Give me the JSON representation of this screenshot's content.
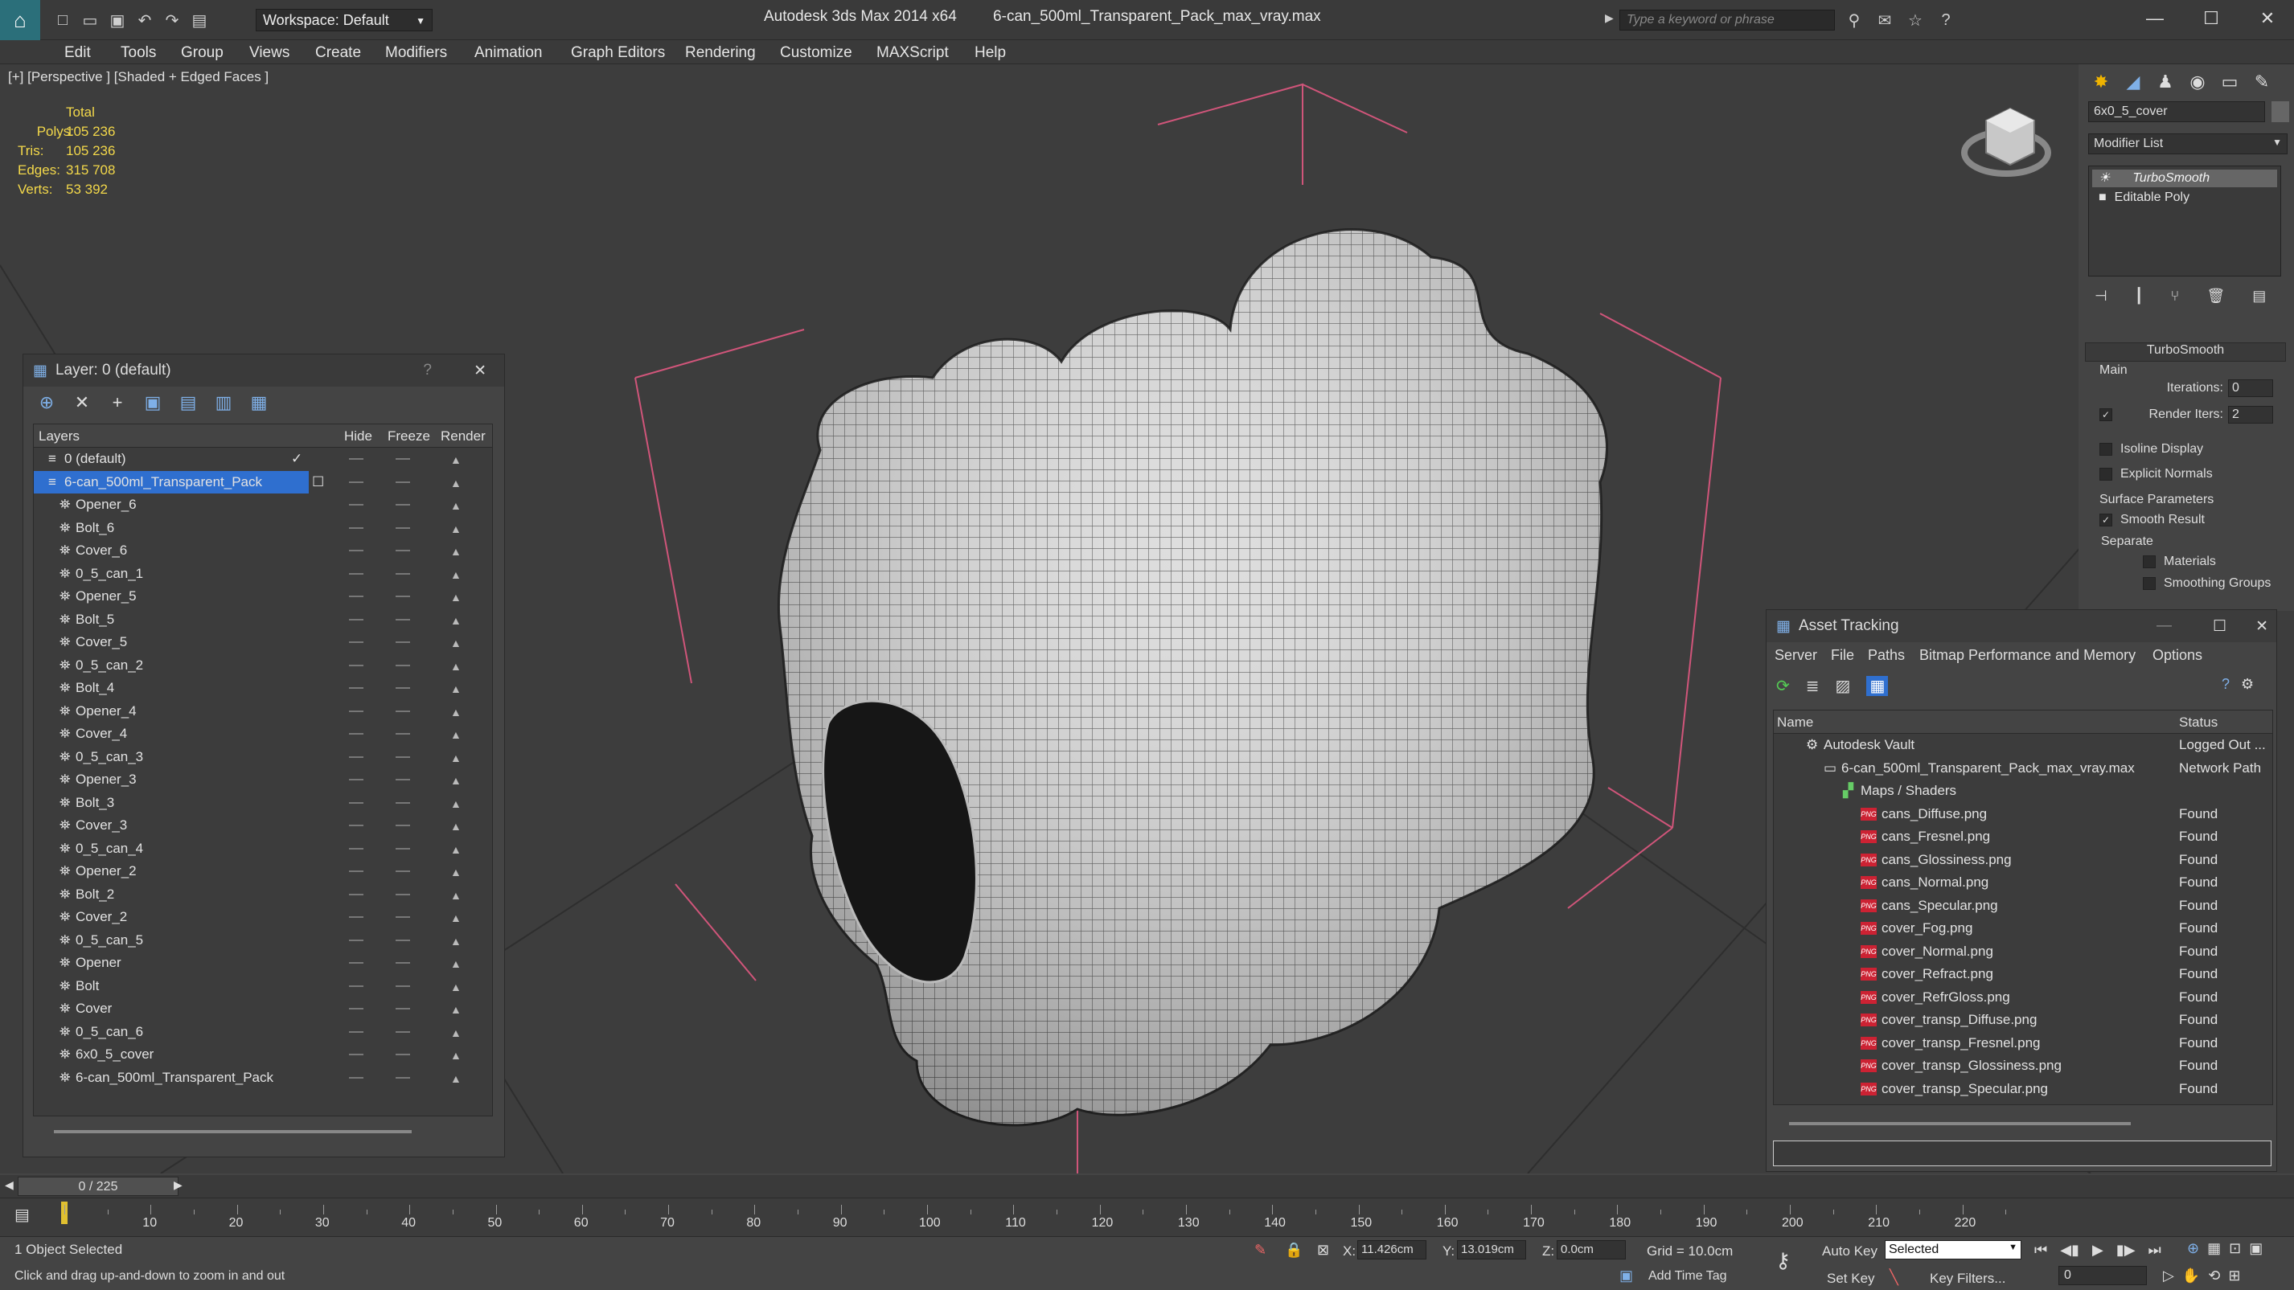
{
  "titlebar": {
    "workspace": "Workspace: Default",
    "app": "Autodesk 3ds Max  2014 x64",
    "file": "6-can_500ml_Transparent_Pack_max_vray.max",
    "search_placeholder": "Type a keyword or phrase"
  },
  "menu": [
    "Edit",
    "Tools",
    "Group",
    "Views",
    "Create",
    "Modifiers",
    "Animation",
    "Graph Editors",
    "Rendering",
    "Customize",
    "MAXScript",
    "Help"
  ],
  "viewport": {
    "label": "[+] [Perspective ] [Shaded + Edged Faces ]",
    "stats_total": "Total",
    "stats": [
      {
        "label": "Polys:",
        "value": "105 236"
      },
      {
        "label": "Tris:",
        "value": "105 236"
      },
      {
        "label": "Edges:",
        "value": "315 708"
      },
      {
        "label": "Verts:",
        "value": "53 392"
      }
    ]
  },
  "layers": {
    "title": "Layer: 0 (default)",
    "help": "?",
    "cols": {
      "name": "Layers",
      "hide": "Hide",
      "freeze": "Freeze",
      "render": "Render"
    },
    "rows": [
      "0 (default)",
      "6-can_500ml_Transparent_Pack",
      "Opener_6",
      "Bolt_6",
      "Cover_6",
      "0_5_can_1",
      "Opener_5",
      "Bolt_5",
      "Cover_5",
      "0_5_can_2",
      "Bolt_4",
      "Opener_4",
      "Cover_4",
      "0_5_can_3",
      "Opener_3",
      "Bolt_3",
      "Cover_3",
      "0_5_can_4",
      "Opener_2",
      "Bolt_2",
      "Cover_2",
      "0_5_can_5",
      "Opener",
      "Bolt",
      "Cover",
      "0_5_can_6",
      "6x0_5_cover",
      "6-can_500ml_Transparent_Pack"
    ]
  },
  "command": {
    "object_name": "6x0_5_cover",
    "modifier_list": "Modifier List",
    "stack": [
      "TurboSmooth",
      "Editable Poly"
    ],
    "rollout": "TurboSmooth",
    "main": "Main",
    "iterations_label": "Iterations:",
    "iterations": "0",
    "render_iters_label": "Render Iters:",
    "render_iters": "2",
    "isoline": "Isoline Display",
    "explicit": "Explicit Normals",
    "surface": "Surface Parameters",
    "smooth": "Smooth Result",
    "separate": "Separate",
    "materials": "Materials",
    "smoothing": "Smoothing Groups"
  },
  "assets": {
    "title": "Asset Tracking",
    "menu": [
      "Server",
      "File",
      "Paths",
      "Bitmap Performance and Memory",
      "Options"
    ],
    "cols": {
      "name": "Name",
      "status": "Status"
    },
    "vault": {
      "name": "Autodesk Vault",
      "status": "Logged Out ..."
    },
    "file": {
      "name": "6-can_500ml_Transparent_Pack_max_vray.max",
      "status": "Network Path"
    },
    "maps": "Maps / Shaders",
    "png_tag": "PNG",
    "items": [
      {
        "name": "cans_Diffuse.png",
        "status": "Found"
      },
      {
        "name": "cans_Fresnel.png",
        "status": "Found"
      },
      {
        "name": "cans_Glossiness.png",
        "status": "Found"
      },
      {
        "name": "cans_Normal.png",
        "status": "Found"
      },
      {
        "name": "cans_Specular.png",
        "status": "Found"
      },
      {
        "name": "cover_Fog.png",
        "status": "Found"
      },
      {
        "name": "cover_Normal.png",
        "status": "Found"
      },
      {
        "name": "cover_Refract.png",
        "status": "Found"
      },
      {
        "name": "cover_RefrGloss.png",
        "status": "Found"
      },
      {
        "name": "cover_transp_Diffuse.png",
        "status": "Found"
      },
      {
        "name": "cover_transp_Fresnel.png",
        "status": "Found"
      },
      {
        "name": "cover_transp_Glossiness.png",
        "status": "Found"
      },
      {
        "name": "cover_transp_Specular.png",
        "status": "Found"
      }
    ]
  },
  "timeline": {
    "frame": "0 / 225",
    "ticks": [
      "10",
      "20",
      "30",
      "40",
      "50",
      "60",
      "70",
      "80",
      "90",
      "100",
      "110",
      "120",
      "130",
      "140",
      "150",
      "160",
      "170",
      "180",
      "190",
      "200",
      "210",
      "220"
    ]
  },
  "status": {
    "selected": "1 Object Selected",
    "hint": "Click and drag up-and-down to zoom in and out",
    "x_label": "X:",
    "x": "11.426cm",
    "y_label": "Y:",
    "y": "13.019cm",
    "z_label": "Z:",
    "z": "0.0cm",
    "grid": "Grid = 10.0cm",
    "autokey": "Auto Key",
    "setkey": "Set Key",
    "selected_mode": "Selected",
    "keyfilters": "Key Filters...",
    "addtimetag": "Add Time Tag",
    "frame_field": "0"
  },
  "colors": {
    "selection": "#2f6fcf",
    "stats": "#f3d84a",
    "gizmo": "#d0557a"
  }
}
